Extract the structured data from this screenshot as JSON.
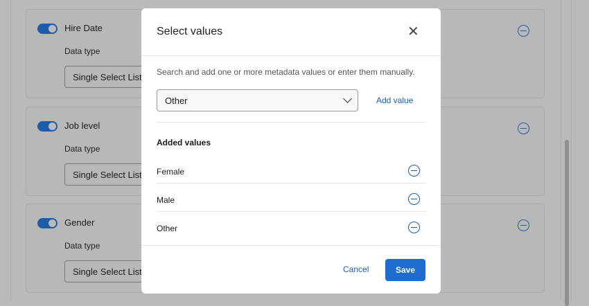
{
  "cards": [
    {
      "title": "Hire Date",
      "data_type_label": "Data type",
      "data_type": "Single Select List"
    },
    {
      "title": "Job level",
      "data_type_label": "Data type",
      "data_type": "Single Select List"
    },
    {
      "title": "Gender",
      "data_type_label": "Data type",
      "data_type": "Single Select List"
    }
  ],
  "modal": {
    "title": "Select values",
    "description": "Search and add one or more metadata values or enter them manually.",
    "dropdown_value": "Other",
    "add_value": "Add value",
    "added_heading": "Added values",
    "added": [
      "Female",
      "Male",
      "Other"
    ],
    "cancel": "Cancel",
    "save": "Save"
  },
  "colors": {
    "accent": "#1f6bd0",
    "overlay": "#bababa"
  }
}
